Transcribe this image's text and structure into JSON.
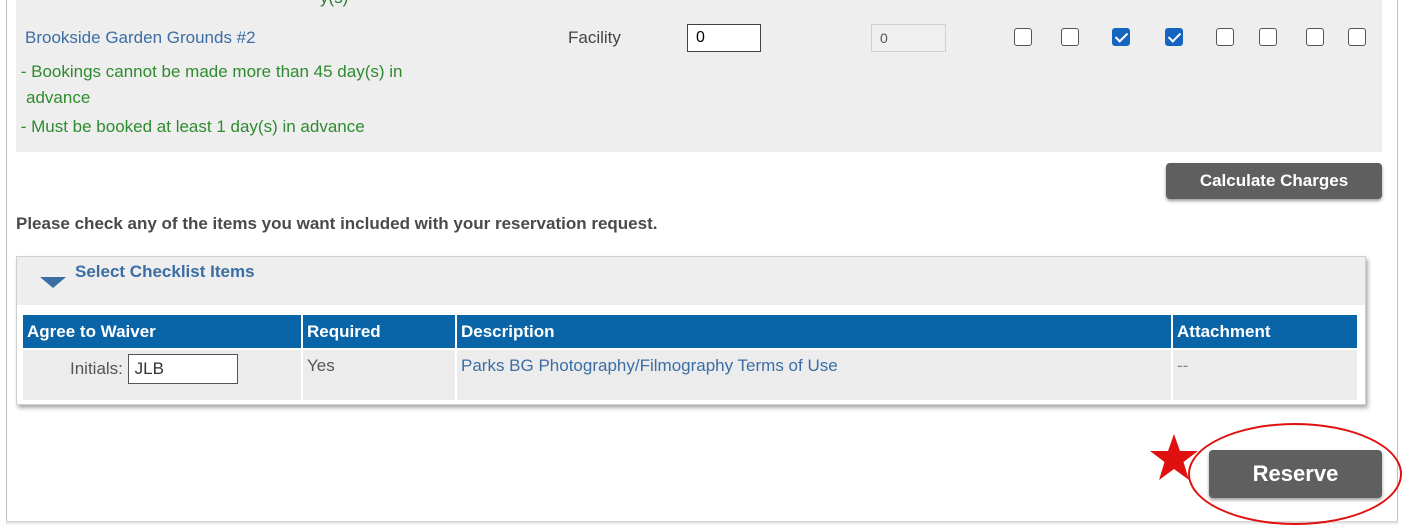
{
  "facility": {
    "cutoff_text": "y(s)",
    "name": "Brookside Garden Grounds #2",
    "rule_1_line1": " - Bookings cannot be made more than 45 day(s) in",
    "rule_1_line2": "advance",
    "rule_2": " - Must be booked at least 1 day(s) in advance",
    "type": "Facility",
    "quantity_value": "0",
    "readonly_value": "0",
    "checkboxes": [
      false,
      false,
      true,
      true,
      false,
      false,
      false,
      false
    ]
  },
  "calculate_button": "Calculate Charges",
  "instruction": "Please check any of the items you want included with your reservation request.",
  "checklist": {
    "title": "Select Checklist Items",
    "columns": [
      "Agree to Waiver",
      "Required",
      "Description",
      "Attachment"
    ],
    "rows": [
      {
        "initials_label": "Initials:",
        "initials_value": "JLB",
        "required": "Yes",
        "description": "Parks BG Photography/Filmography Terms of Use",
        "attachment": "--"
      }
    ]
  },
  "reserve_button": "Reserve",
  "colors": {
    "link_blue": "#3a6ea5",
    "rule_green": "#2e8b2e",
    "header_blue": "#0a64a8",
    "button_grey": "#5f5f5f",
    "checkbox_blue": "#1565c0",
    "annotation_red": "#e01010"
  }
}
